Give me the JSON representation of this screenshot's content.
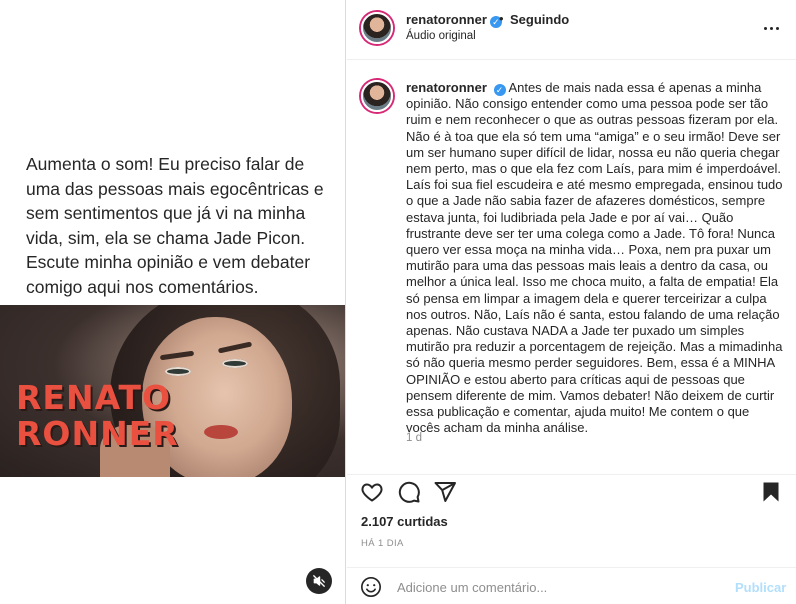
{
  "media": {
    "overlay_text": "Aumenta o som! Eu preciso falar de uma das pessoas mais egocêntricas e sem sentimentos que já vi na minha vida, sim, ela se chama Jade Picon. Escute minha opinião e vem debater comigo aqui nos comentários.",
    "logo_line1": "RENATO",
    "logo_line2": "RONNER",
    "mute_icon": "muted-speaker-icon"
  },
  "header": {
    "username": "renatoronner",
    "dot": "•",
    "follow_status": "Seguindo",
    "audio": "Áudio original",
    "verified_glyph": "✓"
  },
  "caption": {
    "username": "renatoronner",
    "text": "Antes de mais nada essa é apenas a minha opinião. Não consigo entender como uma pessoa pode ser tão ruim e nem reconhecer o que as outras pessoas fizeram por ela. Não é à toa que ela só tem uma “amiga” e o seu irmão! Deve ser um ser humano super difícil de lidar, nossa eu não queria chegar nem perto, mas o que ela fez com Laís, para mim é imperdoável. Laís foi sua fiel escudeira e até mesmo empregada, ensinou tudo o que a Jade não sabia fazer de afazeres domésticos, sempre estava junta, foi ludibriada pela Jade e por aí vai… Quão frustrante deve ser ter uma colega como a Jade. Tô fora! Nunca quero ver essa moça na minha vida… Poxa, nem pra puxar um mutirão para uma das pessoas mais leais a dentro da casa, ou melhor a única leal. Isso me choca muito, a falta de empatia! Ela só pensa em limpar a imagem dela e querer terceirizar a culpa nos outros. Não, Laís não é santa, estou falando de uma relação apenas. Não custava NADA a Jade ter puxado um simples mutirão pra reduzir a porcentagem de rejeição. Mas a mimadinha só não queria mesmo perder seguidores. Bem, essa é a MINHA OPINIÃO e estou aberto para críticas aqui de pessoas que pensem diferente de mim. Vamos debater! Não deixem de curtir essa publicação e comentar, ajuda muito! Me contem o que vocês acham da minha análise.",
    "time": "1 d"
  },
  "actions": {
    "like_icon": "heart-icon",
    "comment_icon": "comment-bubble-icon",
    "share_icon": "paper-plane-icon",
    "save_icon": "bookmark-icon"
  },
  "stats": {
    "likes": "2.107 curtidas",
    "date": "HÁ 1 DIA"
  },
  "comment": {
    "placeholder": "Adicione um comentário...",
    "publish_label": "Publicar",
    "emoji_icon": "smiley-icon"
  },
  "colors": {
    "text": "#262626",
    "muted": "#8e8e8e",
    "accent_blue": "#3897f0",
    "publish_disabled": "#b2dffc",
    "logo_red": "#e9503f"
  }
}
